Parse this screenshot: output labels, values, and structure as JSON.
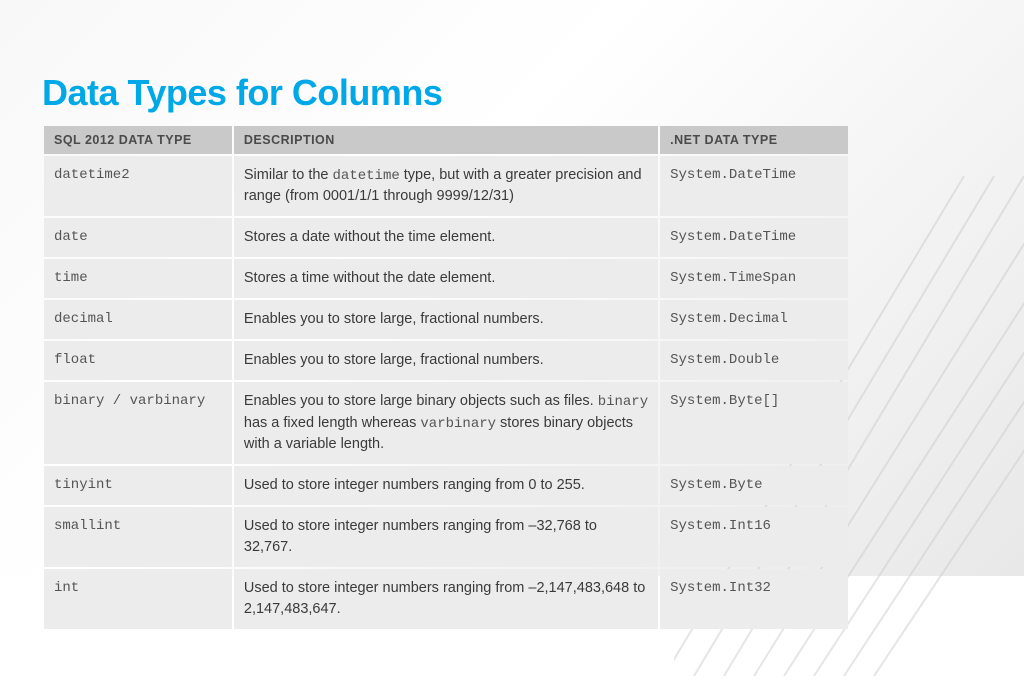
{
  "title": "Data Types for Columns",
  "headers": {
    "sql": "SQL 2012 DATA TYPE",
    "desc": "DESCRIPTION",
    "net": ".NET DATA TYPE"
  },
  "rows": [
    {
      "sql": "datetime2",
      "desc": "Similar to the <span class='mono'>datetime</span> type, but with a greater precision and range (from 0001/1/1 through 9999/12/31)",
      "net": "System.DateTime"
    },
    {
      "sql": "date",
      "desc": "Stores a date without the time element.",
      "net": "System.DateTime"
    },
    {
      "sql": "time",
      "desc": "Stores a time without the date element.",
      "net": "System.TimeSpan"
    },
    {
      "sql": "decimal",
      "desc": "Enables you to store large, fractional numbers.",
      "net": "System.Decimal"
    },
    {
      "sql": "float",
      "desc": "Enables you to store large, fractional numbers.",
      "net": "System.Double"
    },
    {
      "sql": "binary / varbinary",
      "desc": "Enables you to store large binary objects such as files. <span class='mono'>binary</span> has a fixed length whereas <span class='mono'>varbinary</span> stores binary objects with a variable length.",
      "net": "System.Byte[]"
    },
    {
      "sql": "tinyint",
      "desc": "Used to store integer numbers ranging from 0 to 255.",
      "net": "System.Byte"
    },
    {
      "sql": "smallint",
      "desc": "Used to store integer numbers ranging from –32,768 to 32,767.",
      "net": "System.Int16"
    },
    {
      "sql": "int",
      "desc": "Used to store integer numbers ranging from –2,147,483,648 to 2,147,483,647.",
      "net": "System.Int32"
    }
  ]
}
